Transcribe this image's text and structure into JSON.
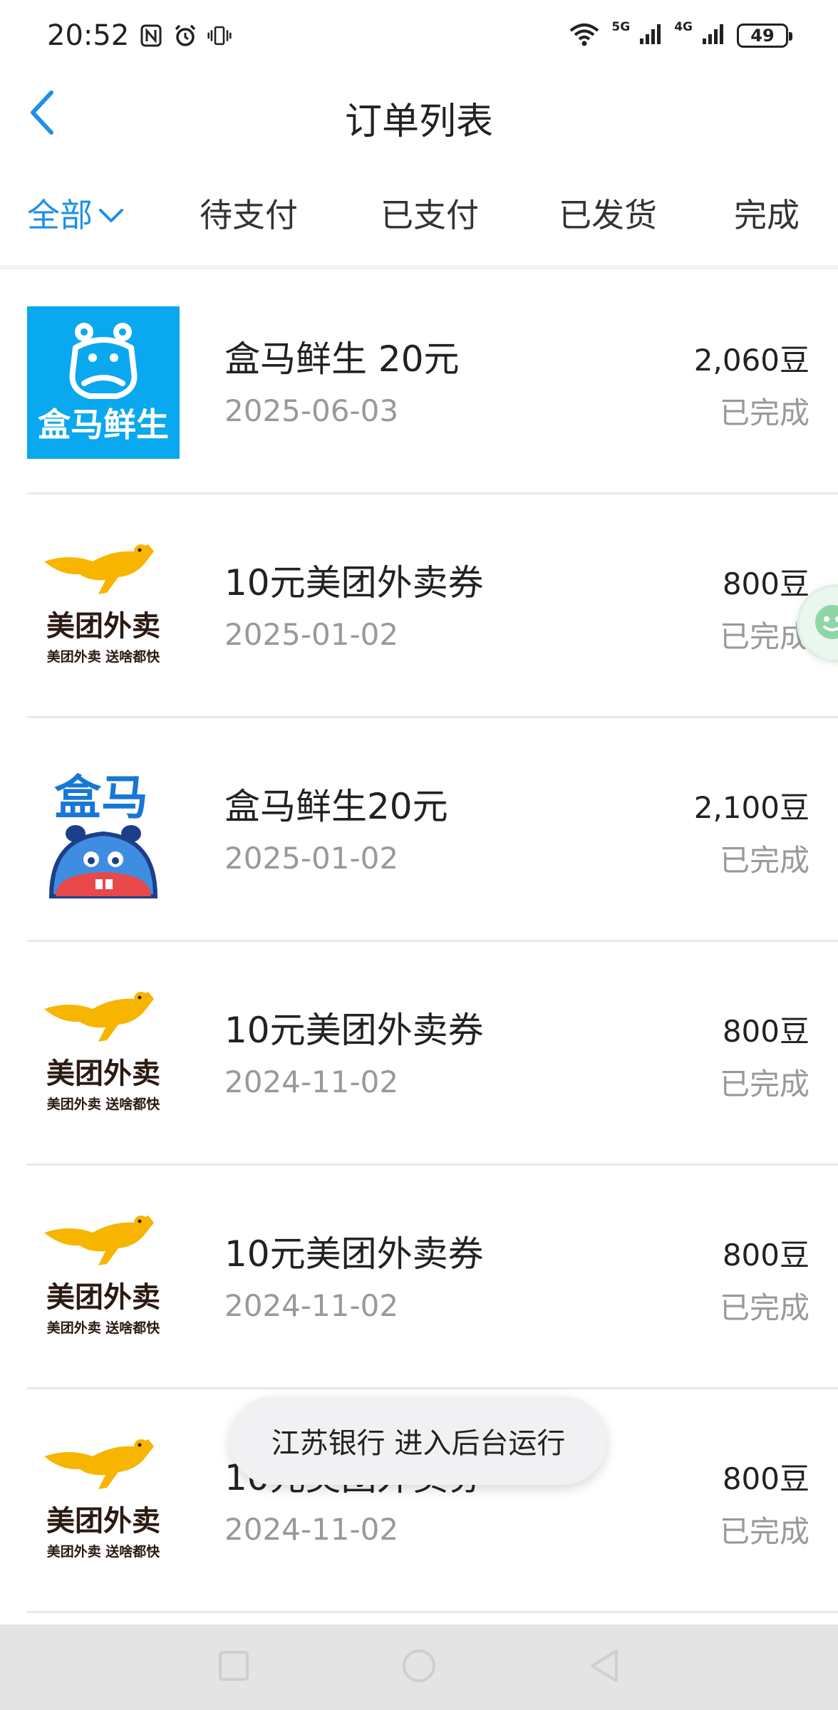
{
  "status_bar": {
    "time": "20:52",
    "signal_5g": "5G",
    "signal_4g": "4G",
    "battery": "49"
  },
  "header": {
    "title": "订单列表"
  },
  "tabs": [
    {
      "label": "全部",
      "active": true
    },
    {
      "label": "待支付",
      "active": false
    },
    {
      "label": "已支付",
      "active": false
    },
    {
      "label": "已发货",
      "active": false
    },
    {
      "label": "完成",
      "active": false
    }
  ],
  "orders": [
    {
      "logo": "hema-logo-square",
      "logo_text": "盒马鲜生",
      "title": "盒马鲜生 20元",
      "date": "2025-06-03",
      "price": "2,060豆",
      "status": "已完成"
    },
    {
      "logo": "meituan-waimai-logo",
      "logo_text": "美团外卖",
      "logo_sub": "美团外卖 送啥都快",
      "title": "10元美团外卖券",
      "date": "2025-01-02",
      "price": "800豆",
      "status": "已完成"
    },
    {
      "logo": "hema-logo-hippo",
      "logo_text": "盒马",
      "title": "盒马鲜生20元",
      "date": "2025-01-02",
      "price": "2,100豆",
      "status": "已完成"
    },
    {
      "logo": "meituan-waimai-logo",
      "logo_text": "美团外卖",
      "logo_sub": "美团外卖 送啥都快",
      "title": "10元美团外卖券",
      "date": "2024-11-02",
      "price": "800豆",
      "status": "已完成"
    },
    {
      "logo": "meituan-waimai-logo",
      "logo_text": "美团外卖",
      "logo_sub": "美团外卖 送啥都快",
      "title": "10元美团外卖券",
      "date": "2024-11-02",
      "price": "800豆",
      "status": "已完成"
    },
    {
      "logo": "meituan-waimai-logo",
      "logo_text": "美团外卖",
      "logo_sub": "美团外卖 送啥都快",
      "title": "10元美团外卖券",
      "date": "2024-11-02",
      "price": "800豆",
      "status": "已完成"
    }
  ],
  "toast": {
    "text": "江苏银行 进入后台运行"
  },
  "colors": {
    "accent": "#1e90e8",
    "hema_blue": "#0aa8ee",
    "meituan_yellow": "#f7b500"
  }
}
